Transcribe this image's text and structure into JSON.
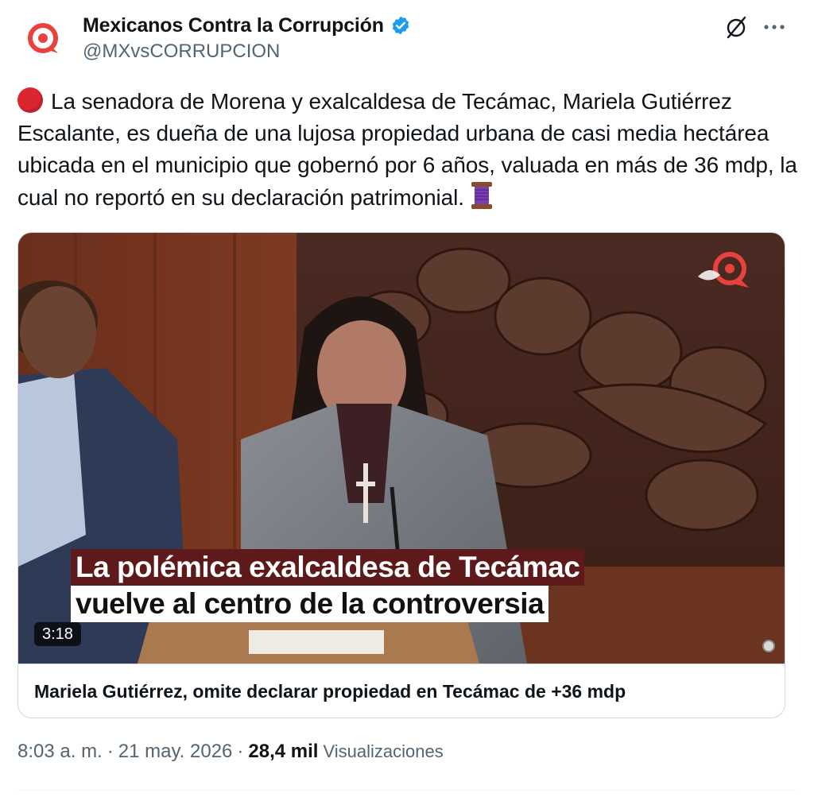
{
  "author": {
    "display_name": "Mexicanos Contra la Corrupción",
    "handle": "@MXvsCORRUPCION",
    "verified": true,
    "brand_color": "#e8423f"
  },
  "actions": {
    "grok_icon": "slashed-circle-icon",
    "more_label": "···"
  },
  "tweet": {
    "text": "La senadora de Morena y exalcaldesa de Tecámac, Mariela Gutiérrez Escalante, es dueña de una lujosa propiedad urbana de casi media hectárea ubicada en el municipio que gobernó por 6 años, valuada en más de 36 mdp, la cual no reportó en su declaración patrimonial.",
    "leading_emoji": "red-circle",
    "trailing_emoji": "thread-spool"
  },
  "media": {
    "caption_line_1": "La polémica exalcaldesa de Tecámac",
    "caption_line_2": "vuelve al centro de la controversia",
    "duration": "3:18",
    "card_title": "Mariela Gutiérrez, omite declarar propiedad en Tecámac de +36 mdp"
  },
  "meta": {
    "time": "8:03 a. m.",
    "separator": "·",
    "date": "21 may. 2026",
    "views_count": "28,4 mil",
    "views_label": "Visualizaciones"
  },
  "colors": {
    "text_primary": "#0f1419",
    "text_secondary": "#536471",
    "verified_blue": "#1d9bf0",
    "border": "#cfd9de"
  }
}
